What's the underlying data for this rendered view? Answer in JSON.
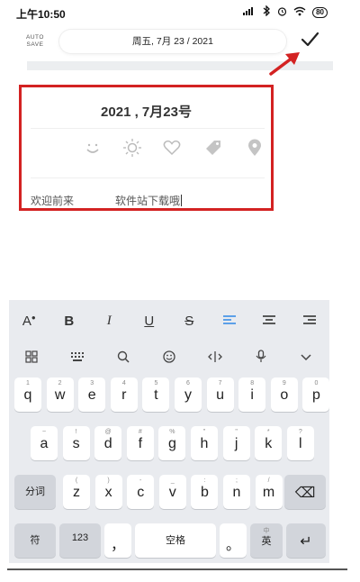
{
  "status_bar": {
    "time": "上午10:50",
    "signal_text": "..II",
    "battery": "80"
  },
  "header": {
    "auto_save_line1": "AUTO",
    "auto_save_line2": "SAVE",
    "date": "周五, 7月 23 / 2021"
  },
  "card": {
    "date_title": "2021 , 7月23号",
    "moods": [
      "smile-icon",
      "sun-icon",
      "heart-icon",
      "tag-icon",
      "location-icon"
    ],
    "text_left": "欢迎前来",
    "text_right": "软件站下载哦"
  },
  "keyboard": {
    "format_buttons": [
      "A⁰",
      "B",
      "I",
      "U",
      "S",
      "≡",
      "≡",
      "≡"
    ],
    "tool_icons": [
      "grid-icon",
      "keyboard-icon",
      "search-icon",
      "emoji-icon",
      "cursor-icon",
      "mic-icon",
      "collapse-icon"
    ],
    "row1": [
      {
        "k": "q",
        "s": "1"
      },
      {
        "k": "w",
        "s": "2"
      },
      {
        "k": "e",
        "s": "3"
      },
      {
        "k": "r",
        "s": "4"
      },
      {
        "k": "t",
        "s": "5"
      },
      {
        "k": "y",
        "s": "6"
      },
      {
        "k": "u",
        "s": "7"
      },
      {
        "k": "i",
        "s": "8"
      },
      {
        "k": "o",
        "s": "9"
      },
      {
        "k": "p",
        "s": "0"
      }
    ],
    "row2": [
      {
        "k": "a",
        "s": "~"
      },
      {
        "k": "s",
        "s": "!"
      },
      {
        "k": "d",
        "s": "@"
      },
      {
        "k": "f",
        "s": "#"
      },
      {
        "k": "g",
        "s": "%"
      },
      {
        "k": "h",
        "s": "\""
      },
      {
        "k": "j",
        "s": "\""
      },
      {
        "k": "k",
        "s": "*"
      },
      {
        "k": "l",
        "s": "?"
      }
    ],
    "row3": [
      {
        "k": "z",
        "s": "("
      },
      {
        "k": "x",
        "s": ")"
      },
      {
        "k": "c",
        "s": "-"
      },
      {
        "k": "v",
        "s": "_"
      },
      {
        "k": "b",
        "s": ":"
      },
      {
        "k": "n",
        "s": ";"
      },
      {
        "k": "m",
        "s": "/"
      }
    ],
    "fenci": "分词",
    "fu": "符",
    "num": "123",
    "comma": "，",
    "space": "空格",
    "period": "。",
    "lang_en": "英",
    "lang_zh": "中",
    "enter": "↵",
    "backspace": "⌫"
  }
}
